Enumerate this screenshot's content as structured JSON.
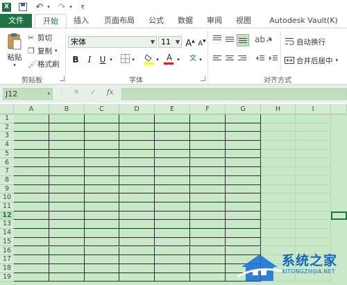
{
  "quick_access": {
    "logo": "X",
    "undo": "↶",
    "redo": "↷"
  },
  "tabs": [
    {
      "label": "文件"
    },
    {
      "label": "开始"
    },
    {
      "label": "插入"
    },
    {
      "label": "页面布局"
    },
    {
      "label": "公式"
    },
    {
      "label": "数据"
    },
    {
      "label": "审阅"
    },
    {
      "label": "视图"
    },
    {
      "label": "Autodesk Vault(K)"
    }
  ],
  "ribbon": {
    "clipboard": {
      "paste": "粘贴",
      "cut": "剪切",
      "copy": "复制",
      "format_painter": "格式刷",
      "group_label": "剪贴板"
    },
    "font": {
      "font_name": "宋体",
      "font_size": "11",
      "bold": "B",
      "italic": "I",
      "underline": "U",
      "wen": "文",
      "grow": "A",
      "shrink": "A",
      "font_color": "A",
      "group_label": "字体"
    },
    "alignment": {
      "wrap_text": "自动换行",
      "merge_center": "合并后居中",
      "group_label": "对齐方式"
    }
  },
  "formula_bar": {
    "name_box": "J12",
    "fx": "fx",
    "cancel": "✕",
    "enter": "✓",
    "formula": ""
  },
  "sheet": {
    "columns": [
      "A",
      "B",
      "C",
      "D",
      "E",
      "F",
      "G",
      "H",
      "I"
    ],
    "rows": [
      "1",
      "2",
      "3",
      "4",
      "5",
      "6",
      "7",
      "8",
      "9",
      "10",
      "11",
      "12",
      "13",
      "14",
      "15",
      "16",
      "17",
      "18",
      "19"
    ],
    "selected_row": "12"
  },
  "watermark": {
    "title": "系统之家",
    "url": "XITONGZHIJIA.NET"
  },
  "colors": {
    "accent": "#217346",
    "grid_bg": "#c7e9c7"
  }
}
